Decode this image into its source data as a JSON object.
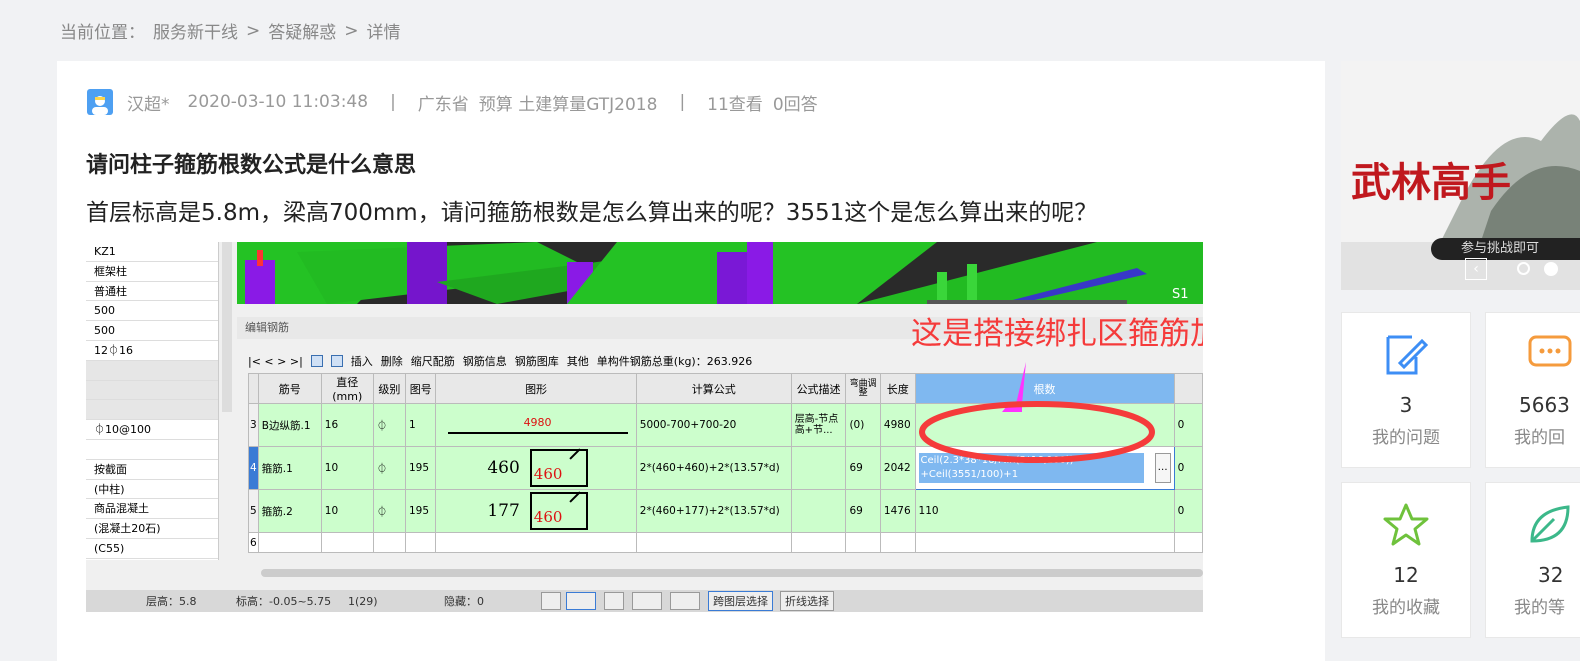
{
  "breadcrumb": {
    "prefix": "当前位置：",
    "items": [
      "服务新干线",
      "答疑解惑",
      "详情"
    ],
    "separator": ">"
  },
  "post": {
    "author": "汉超*",
    "datetime": "2020-03-10 11:03:48",
    "separator": "|",
    "region": "广东省",
    "category": "预算 土建算量GTJ2018",
    "views": "11查看",
    "answers": "0回答",
    "title": "请问柱子箍筋根数公式是什么意思",
    "body": "首层标高是5.8m，梁高700mm，请问箍筋根数是怎么算出来的呢？3551这个是怎么算出来的呢？"
  },
  "screenshot": {
    "left_props": [
      "KZ1",
      "框架柱",
      "普通柱",
      "500",
      "500",
      "12⏀16",
      "",
      "",
      "",
      "⏀10@100",
      "",
      "按截面",
      "(中柱)",
      "商品混凝土",
      "(混凝土20石)",
      "(C55)"
    ],
    "view3d_label": "S1",
    "edit_title": "编辑钢筋",
    "toolbar": {
      "nav": "|<  <  >  >|",
      "insert": "插入",
      "delete": "删除",
      "ruler": "缩尺配筋",
      "info": "钢筋信息",
      "library": "钢筋图库",
      "other": "其他",
      "weight": "单构件钢筋总重(kg)：263.926"
    },
    "columns": [
      "筋号",
      "直径(mm)",
      "级别",
      "图号",
      "图形",
      "计算公式",
      "公式描述",
      "弯曲调整",
      "长度",
      "根数"
    ],
    "rows": [
      {
        "idx": "3",
        "name": "B边纵筋.1",
        "dia": "16",
        "grade": "⏀",
        "fig": "1",
        "shape_value": "4980",
        "formula": "5000-700+700-20",
        "desc": "层高-节点高+节...",
        "bend": "(0)",
        "length": "4980",
        "count": "",
        "extra": "0"
      },
      {
        "idx": "4",
        "name": "箍筋.1",
        "dia": "10",
        "grade": "⏀",
        "fig": "195",
        "shape_a": "460",
        "shape_b": "460",
        "formula": "2*(460+460)+2*(13.57*d)",
        "desc": "",
        "bend": "69",
        "length": "2042",
        "count": "Ceil(2.3*38*16/Min(5*16,100)) +Ceil(3551/100)+1",
        "extra": "0"
      },
      {
        "idx": "5",
        "name": "箍筋.2",
        "dia": "10",
        "grade": "⏀",
        "fig": "195",
        "shape_a": "177",
        "shape_b": "460",
        "formula": "2*(460+177)+2*(13.57*d)",
        "desc": "",
        "bend": "69",
        "length": "1476",
        "count": "110",
        "extra": "0"
      }
    ],
    "empty_row_idx": "6",
    "status": {
      "floor_height": "层高：5.8",
      "elevation": "标高：-0.05~5.75",
      "count": "1(29)",
      "hidden": "隐藏：0",
      "btn_cross": "跨图层选择",
      "btn_polyline": "折线选择"
    },
    "annotation": "这是搭接绑扎区箍筋加密",
    "colors": {
      "grid_green": "#ccfecc",
      "annotation_red": "#f53b3b",
      "header_blue": "#7fb8f0"
    }
  },
  "sidebar": {
    "banner_text": "武林高手",
    "banner_sub": "参与挑战即可",
    "stats": [
      {
        "num": "3",
        "label": "我的问题",
        "icon": "edit-icon",
        "color": "#3d8ef5"
      },
      {
        "num": "5663",
        "label": "我的回",
        "icon": "chat-icon",
        "color": "#f59b3d"
      },
      {
        "num": "12",
        "label": "我的收藏",
        "icon": "star-icon",
        "color": "#6fc23c"
      },
      {
        "num": "32",
        "label": "我的等",
        "icon": "leaf-icon",
        "color": "#3cb88a"
      }
    ]
  }
}
